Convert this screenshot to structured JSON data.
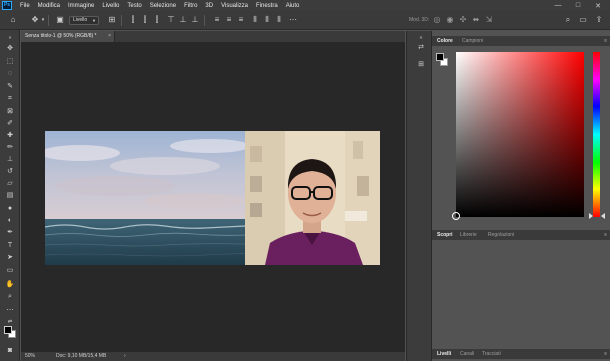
{
  "app": {
    "logo": "Ps"
  },
  "menu": {
    "items": [
      "File",
      "Modifica",
      "Immagine",
      "Livello",
      "Testo",
      "Selezione",
      "Filtro",
      "3D",
      "Visualizza",
      "Finestra",
      "Aiuto"
    ]
  },
  "window_controls": {
    "minimize": "—",
    "maximize": "□",
    "close": "✕"
  },
  "options_bar": {
    "select_value": "Livello",
    "mode_3d_label": "Mod. 3D:",
    "icons": [
      "home-icon",
      "move-icon",
      "auto-select-icon",
      "transform-controls-icon",
      "align-icons",
      "distribute-icons",
      "3d-orbit-icons",
      "search-icon",
      "workspace-icon",
      "share-icon"
    ]
  },
  "document": {
    "tab_title": "Senza titolo-1 @ 50% (RGB/8) *",
    "tab_close": "×"
  },
  "status_bar": {
    "zoom": "50%",
    "doc_info": "Doc: 9,10 MB/15,4 MB",
    "arrow": "›"
  },
  "panels": {
    "color": {
      "tabs": [
        "Colore",
        "Campioni"
      ],
      "active_tab": "Colore",
      "foreground_color": "#000000",
      "background_color": "#ffffff",
      "hue": "#ff0000"
    },
    "learn": {
      "tabs": [
        "Scopri",
        "Librerie",
        "Regolazioni"
      ],
      "active_tab": "Scopri"
    },
    "layers": {
      "tabs": [
        "Livelli",
        "Canali",
        "Tracciati"
      ],
      "active_tab": "Livelli"
    },
    "menu_glyph": "≡"
  }
}
